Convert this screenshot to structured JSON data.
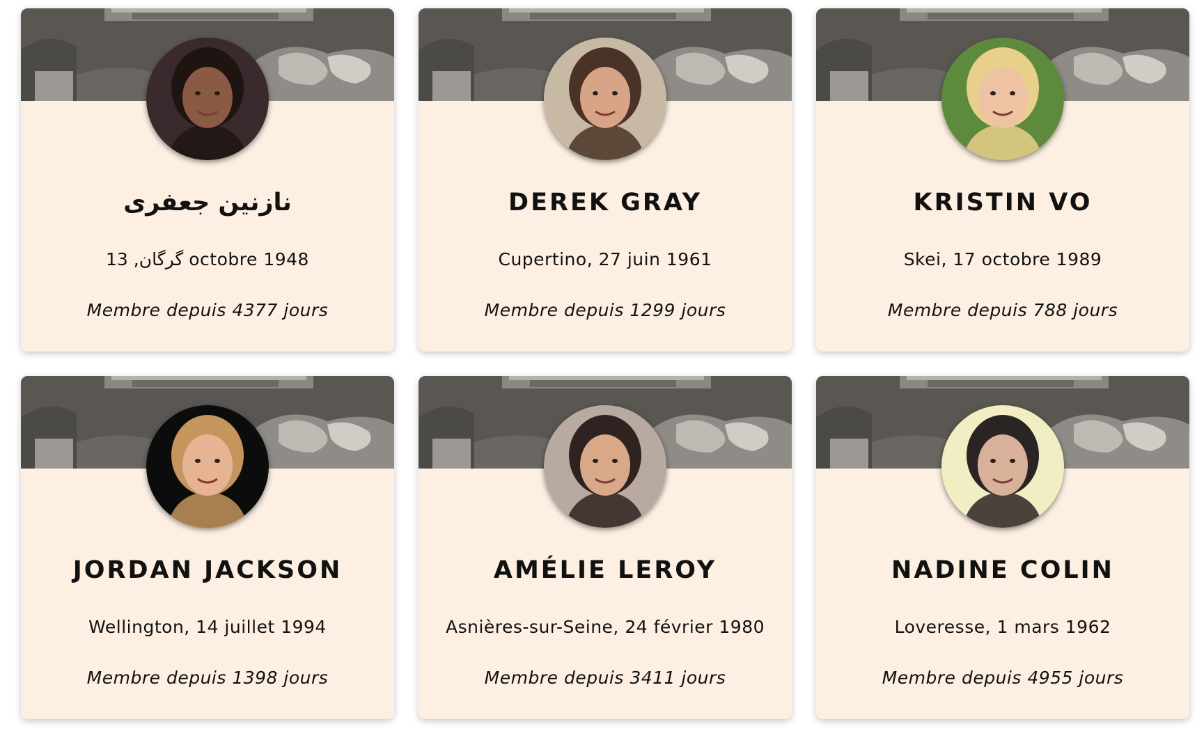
{
  "profiles": [
    {
      "name": "نازنین جعفری",
      "origin": "گرگان, 13 octobre 1948",
      "member_prefix": "Membre depuis",
      "days": "4377",
      "member_suffix": "jours",
      "avatar_bg": "#3a2a2e",
      "avatar_skin": "#8a5a44",
      "avatar_hair": "#1e1512"
    },
    {
      "name": "DEREK GRAY",
      "origin": "Cupertino, 27 juin 1961",
      "member_prefix": "Membre depuis",
      "days": "1299",
      "member_suffix": "jours",
      "avatar_bg": "#c7b9a4",
      "avatar_skin": "#d8a488",
      "avatar_hair": "#4a3226"
    },
    {
      "name": "KRISTIN VO",
      "origin": "Skei, 17 octobre 1989",
      "member_prefix": "Membre depuis",
      "days": "788",
      "member_suffix": "jours",
      "avatar_bg": "#5e8a3e",
      "avatar_skin": "#eec3a4",
      "avatar_hair": "#e8cf8a"
    },
    {
      "name": "JORDAN JACKSON",
      "origin": "Wellington, 14 juillet 1994",
      "member_prefix": "Membre depuis",
      "days": "1398",
      "member_suffix": "jours",
      "avatar_bg": "#0d0c0c",
      "avatar_skin": "#e6b493",
      "avatar_hair": "#c4955c"
    },
    {
      "name": "AMÉLIE LEROY",
      "origin": "Asnières-sur-Seine, 24 février 1980",
      "member_prefix": "Membre depuis",
      "days": "3411",
      "member_suffix": "jours",
      "avatar_bg": "#b8a9a1",
      "avatar_skin": "#d9a888",
      "avatar_hair": "#2e2320"
    },
    {
      "name": "NADINE COLIN",
      "origin": "Loveresse, 1 mars 1962",
      "member_prefix": "Membre depuis",
      "days": "4955",
      "member_suffix": "jours",
      "avatar_bg": "#f2eec4",
      "avatar_skin": "#d9b09a",
      "avatar_hair": "#2b2424"
    }
  ],
  "colors": {
    "card_background": "#fdf0e2",
    "banner_tone": "#5e5b57",
    "text": "#111111"
  }
}
